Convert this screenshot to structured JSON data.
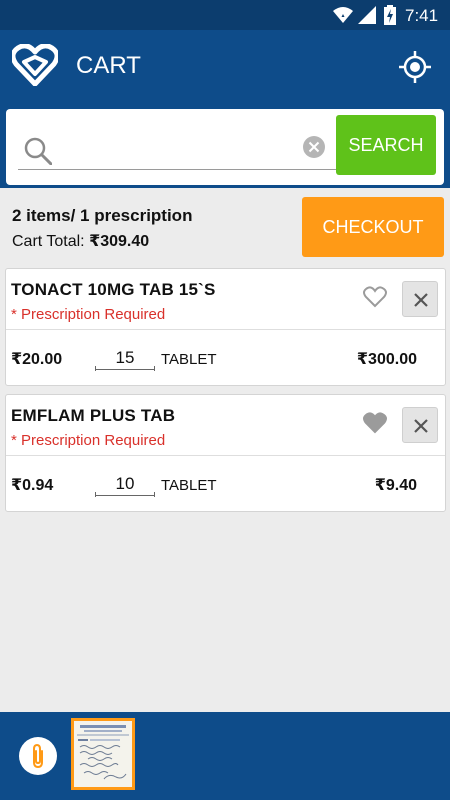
{
  "status_bar": {
    "time": "7:41"
  },
  "app_bar": {
    "title": "CART",
    "logo_icon": "heart-logo-icon",
    "locate_icon": "gps-locate-icon"
  },
  "search": {
    "value": "",
    "placeholder": "",
    "button_label": "SEARCH"
  },
  "summary": {
    "count_text": "2 items/ 1 prescription",
    "total_label": "Cart Total:",
    "total_value": "₹309.40",
    "checkout_label": "CHECKOUT"
  },
  "cart_items": [
    {
      "name": "TONACT 10MG TAB 15`S",
      "rx_note": "* Prescription Required",
      "price": "₹20.00",
      "quantity": "15",
      "unit": "TABLET",
      "subtotal": "₹300.00",
      "favorited": false
    },
    {
      "name": "EMFLAM PLUS TAB",
      "rx_note": "* Prescription Required",
      "price": "₹0.94",
      "quantity": "10",
      "unit": "TABLET",
      "subtotal": "₹9.40",
      "favorited": true
    }
  ],
  "colors": {
    "primary": "#0e4c8a",
    "status_bar": "#0c3d6e",
    "search_button": "#5fc21a",
    "checkout_button": "#ff9a16",
    "prescription_text": "#d9312b"
  }
}
